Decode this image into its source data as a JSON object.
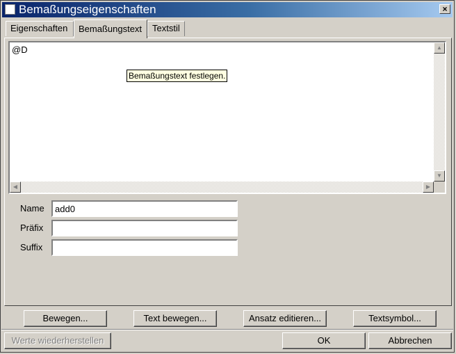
{
  "window": {
    "title": "Bemaßungseigenschaften",
    "close_label": "×"
  },
  "tabs": [
    {
      "label": "Eigenschaften"
    },
    {
      "label": "Bemaßungstext"
    },
    {
      "label": "Textstil"
    }
  ],
  "editor": {
    "content": "@D",
    "tooltip": "Bemaßungstext festlegen."
  },
  "fields": {
    "name": {
      "label": "Name",
      "value": "add0"
    },
    "prefix": {
      "label": "Präfix",
      "value": ""
    },
    "suffix": {
      "label": "Suffix",
      "value": ""
    }
  },
  "actions": {
    "move": "Bewegen...",
    "move_text": "Text bewegen...",
    "edit_extension": "Ansatz editieren...",
    "text_symbol": "Textsymbol..."
  },
  "footer": {
    "restore": "Werte wiederherstellen",
    "ok": "OK",
    "cancel": "Abbrechen"
  }
}
